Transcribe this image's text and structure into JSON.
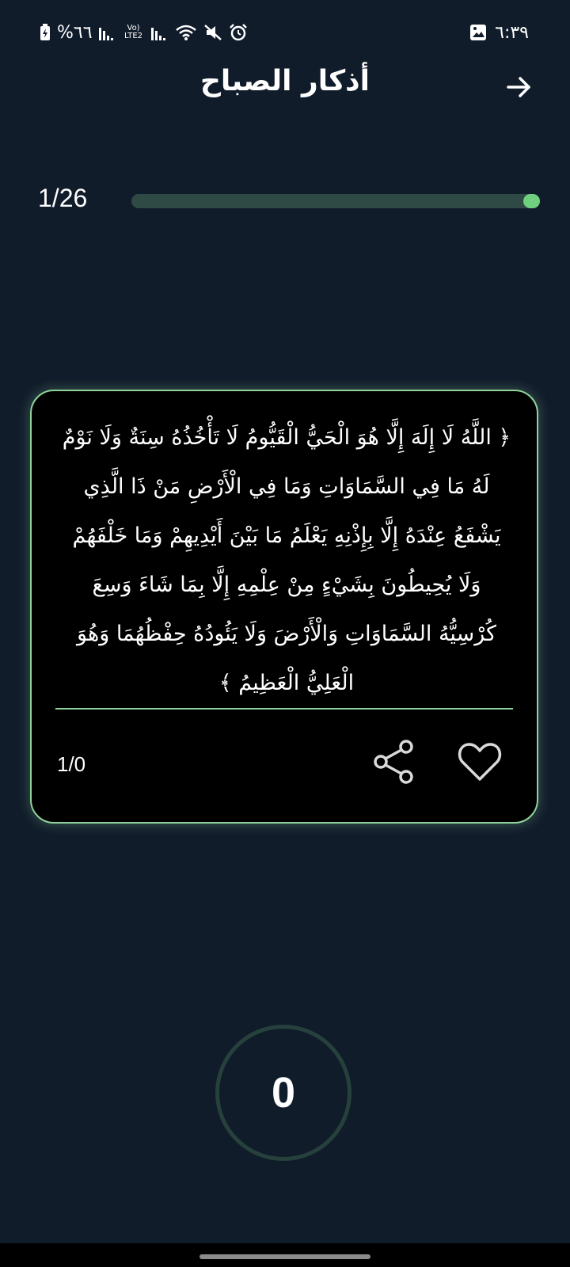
{
  "status_bar": {
    "time": "٦:٣٩",
    "battery": "%٦٦",
    "network_label": "Vo) LTE2"
  },
  "header": {
    "title": "أذكار الصباح"
  },
  "progress": {
    "counter": "1/26",
    "fraction": 0.04
  },
  "card": {
    "text": "﴿ اللَّهُ لَا إِلَهَ إِلَّا هُوَ الْحَيُّ الْقَيُّومُ لَا تَأْخُذُهُ سِنَةٌ وَلَا نَوْمٌ لَهُ مَا فِي السَّمَاوَاتِ وَمَا فِي الْأَرْضِ مَنْ ذَا الَّذِي يَشْفَعُ عِنْدَهُ إِلَّا بِإِذْنِهِ يَعْلَمُ مَا بَيْنَ أَيْدِيهِمْ وَمَا خَلْفَهُمْ وَلَا يُحِيطُونَ بِشَيْءٍ مِنْ عِلْمِهِ إِلَّا بِمَا شَاءَ وَسِعَ كُرْسِيُّهُ السَّمَاوَاتِ وَالْأَرْضَ وَلَا يَئُودُهُ حِفْظُهُمَا وَهُوَ الْعَلِيُّ الْعَظِيمُ ﴾",
    "count": "1/0",
    "share_icon": "share-icon",
    "favorite_icon": "heart-icon"
  },
  "counter": {
    "value": "0"
  },
  "colors": {
    "background": "#111c2b",
    "accent": "#6fcf7f",
    "card_border": "#8fd39a",
    "track": "#2f4a45"
  }
}
